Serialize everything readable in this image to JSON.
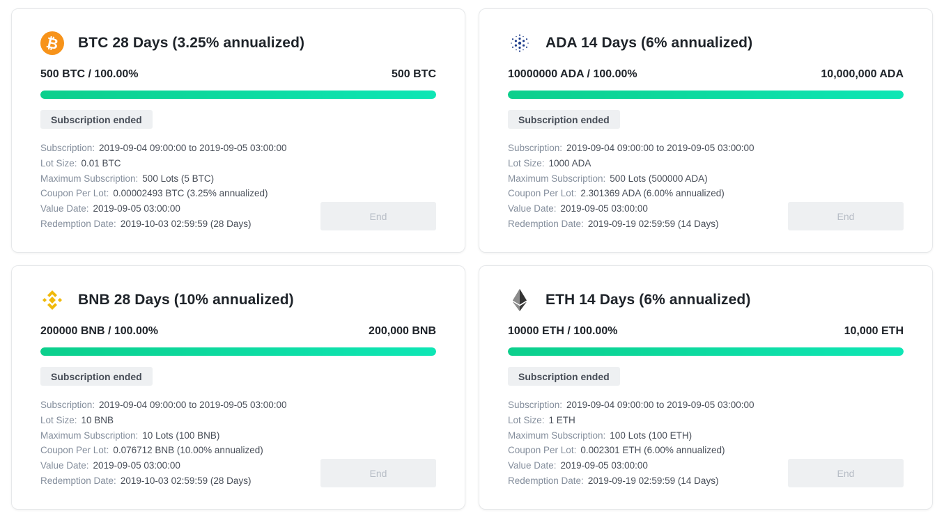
{
  "colors": {
    "progress_start": "#0ccf8c",
    "progress_end": "#0ee6b5",
    "btc": "#f7931a",
    "ada": "#1f3e8c",
    "bnb": "#f0b90b",
    "eth": "#343434"
  },
  "labels": {
    "subscription": "Subscription:",
    "lot_size": "Lot Size:",
    "max_subscription": "Maximum Subscription:",
    "coupon_per_lot": "Coupon Per Lot:",
    "value_date": "Value Date:",
    "redemption_date": "Redemption Date:"
  },
  "products": [
    {
      "icon": "btc-icon",
      "title": "BTC 28 Days (3.25% annualized)",
      "progress_text": "500 BTC / 100.00%",
      "total": "500 BTC",
      "progress_fraction": 1.0,
      "status": "Subscription ended",
      "subscription": "2019-09-04 09:00:00 to 2019-09-05 03:00:00",
      "lot_size": "0.01 BTC",
      "max_subscription": "500 Lots (5 BTC)",
      "coupon_per_lot": "0.00002493 BTC (3.25% annualized)",
      "value_date": "2019-09-05 03:00:00",
      "redemption_date": "2019-10-03 02:59:59 (28 Days)",
      "button": "End"
    },
    {
      "icon": "ada-icon",
      "title": "ADA 14 Days (6% annualized)",
      "progress_text": "10000000 ADA / 100.00%",
      "total": "10,000,000 ADA",
      "progress_fraction": 1.0,
      "status": "Subscription ended",
      "subscription": "2019-09-04 09:00:00 to 2019-09-05 03:00:00",
      "lot_size": "1000 ADA",
      "max_subscription": "500 Lots (500000 ADA)",
      "coupon_per_lot": "2.301369 ADA (6.00% annualized)",
      "value_date": "2019-09-05 03:00:00",
      "redemption_date": "2019-09-19 02:59:59 (14 Days)",
      "button": "End"
    },
    {
      "icon": "bnb-icon",
      "title": "BNB 28 Days (10% annualized)",
      "progress_text": "200000 BNB / 100.00%",
      "total": "200,000 BNB",
      "progress_fraction": 1.0,
      "status": "Subscription ended",
      "subscription": "2019-09-04 09:00:00 to 2019-09-05 03:00:00",
      "lot_size": "10 BNB",
      "max_subscription": "10 Lots (100 BNB)",
      "coupon_per_lot": "0.076712 BNB (10.00% annualized)",
      "value_date": "2019-09-05 03:00:00",
      "redemption_date": "2019-10-03 02:59:59 (28 Days)",
      "button": "End"
    },
    {
      "icon": "eth-icon",
      "title": "ETH 14 Days (6% annualized)",
      "progress_text": "10000 ETH / 100.00%",
      "total": "10,000 ETH",
      "progress_fraction": 1.0,
      "status": "Subscription ended",
      "subscription": "2019-09-04 09:00:00 to 2019-09-05 03:00:00",
      "lot_size": "1 ETH",
      "max_subscription": "100 Lots (100 ETH)",
      "coupon_per_lot": "0.002301 ETH (6.00% annualized)",
      "value_date": "2019-09-05 03:00:00",
      "redemption_date": "2019-09-19 02:59:59 (14 Days)",
      "button": "End"
    }
  ]
}
